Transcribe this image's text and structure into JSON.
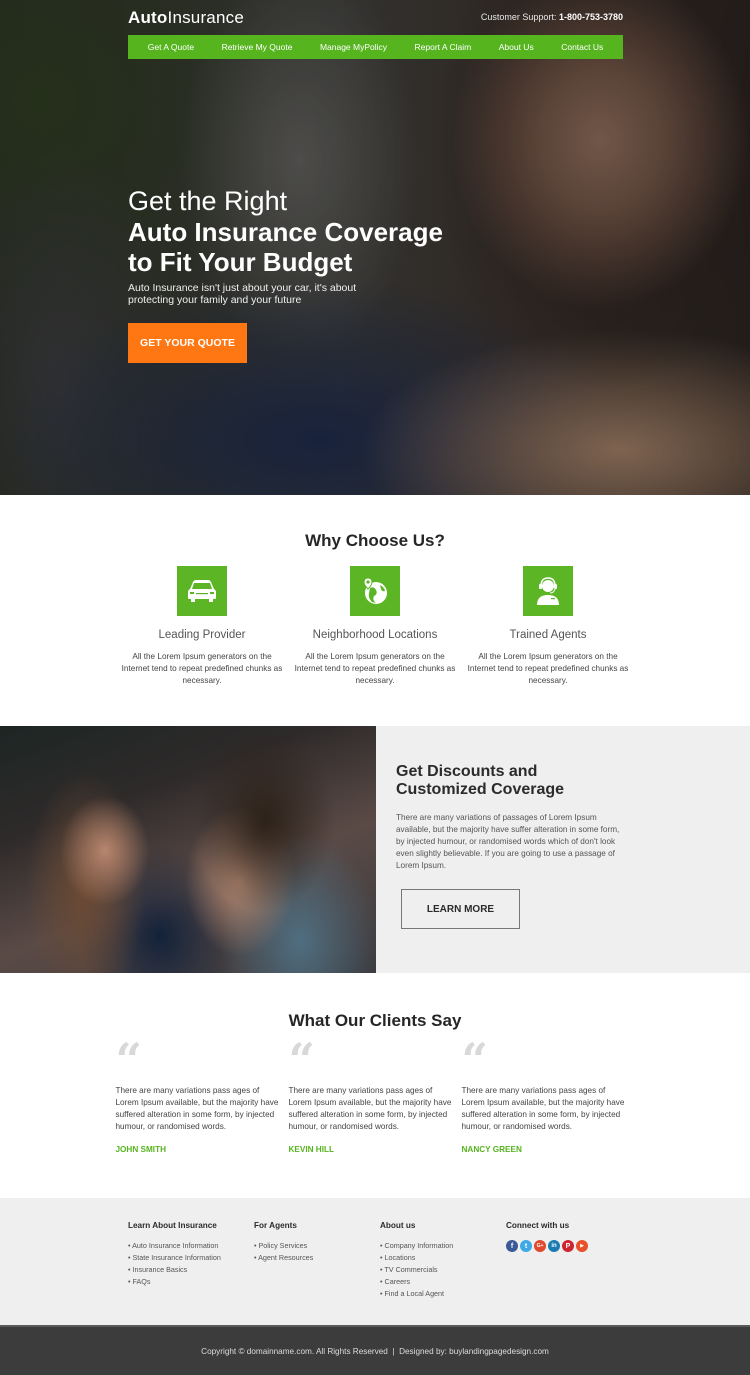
{
  "header": {
    "logo_bold": "Auto",
    "logo_light": "Insurance",
    "support_label": "Customer Support:",
    "support_phone": "1-800-753-3780"
  },
  "nav": {
    "items": [
      {
        "label": "Get A Quote"
      },
      {
        "label": "Retrieve My Quote"
      },
      {
        "label": "Manage MyPolicy"
      },
      {
        "label": "Report A Claim"
      },
      {
        "label": "About Us"
      },
      {
        "label": "Contact Us"
      }
    ]
  },
  "hero": {
    "line1": "Get the Right",
    "line2": "Auto Insurance Coverage",
    "line3": "to Fit Your Budget",
    "subtitle": "Auto Insurance isn't just about your car, it's about protecting your family and your future",
    "cta_label": "GET YOUR QUOTE"
  },
  "why": {
    "title": "Why Choose Us?",
    "features": [
      {
        "icon": "car-icon",
        "title": "Leading Provider",
        "desc": "All the Lorem Ipsum generators on the Internet tend to repeat predefined chunks as necessary."
      },
      {
        "icon": "globe-location-icon",
        "title": "Neighborhood Locations",
        "desc": "All the Lorem Ipsum generators on the Internet tend to repeat predefined chunks as necessary."
      },
      {
        "icon": "headset-agent-icon",
        "title": "Trained Agents",
        "desc": "All the Lorem Ipsum generators on the Internet tend to repeat predefined chunks as necessary."
      }
    ]
  },
  "discount": {
    "title_line1": "Get Discounts and",
    "title_line2": "Customized Coverage",
    "text": "There are many variations of passages of Lorem Ipsum available, but the majority have suffer alteration in some form, by injected humour, or randomised words which of don't look even slightly believable. If you are going to use a passage of Lorem Ipsum.",
    "button_label": "LEARN MORE"
  },
  "clients": {
    "title": "What Our Clients Say",
    "quote_glyph": "“",
    "testimonials": [
      {
        "text": "There are many variations pass ages of Lorem Ipsum available, but the majority have suffered alteration in some form, by injected humour, or randomised words.",
        "name": "JOHN SMITH"
      },
      {
        "text": "There are many variations pass ages of Lorem Ipsum available, but the majority have suffered alteration in some form, by injected humour, or randomised words.",
        "name": "KEVIN HILL"
      },
      {
        "text": "There are many variations pass ages of Lorem Ipsum available, but the majority have suffered alteration in some form, by injected humour, or randomised words.",
        "name": "NANCY GREEN"
      }
    ]
  },
  "footer": {
    "columns": [
      {
        "title": "Learn About Insurance",
        "links": [
          "Auto Insurance Information",
          "State Insurance Information",
          "Insurance Basics",
          "FAQs"
        ]
      },
      {
        "title": "For Agents",
        "links": [
          "Policy Services",
          "Agent Resources"
        ]
      },
      {
        "title": "About us",
        "links": [
          "Company Information",
          "Locations",
          "TV Commercials",
          "Careers",
          "Find a Local Agent"
        ]
      }
    ],
    "connect_title": "Connect with us",
    "socials": [
      {
        "name": "facebook-icon",
        "glyph": "f",
        "color": "#3b5998"
      },
      {
        "name": "twitter-icon",
        "glyph": "t",
        "color": "#3fa9e5"
      },
      {
        "name": "google-plus-icon",
        "glyph": "G+",
        "color": "#e0482f"
      },
      {
        "name": "linkedin-icon",
        "glyph": "in",
        "color": "#1a7bb1"
      },
      {
        "name": "pinterest-icon",
        "glyph": "P",
        "color": "#cf2530"
      },
      {
        "name": "youtube-icon",
        "glyph": "▶",
        "color": "#e8502a"
      }
    ],
    "copyright": "Copyright © domainname.com. All Rights Reserved  |  Designed by: buylandingpagedesign.com"
  },
  "colors": {
    "brand_green": "#56b51f",
    "cta_orange": "#ff7712",
    "footer_dark": "#3c3c3c",
    "light_bg": "#efefef"
  }
}
